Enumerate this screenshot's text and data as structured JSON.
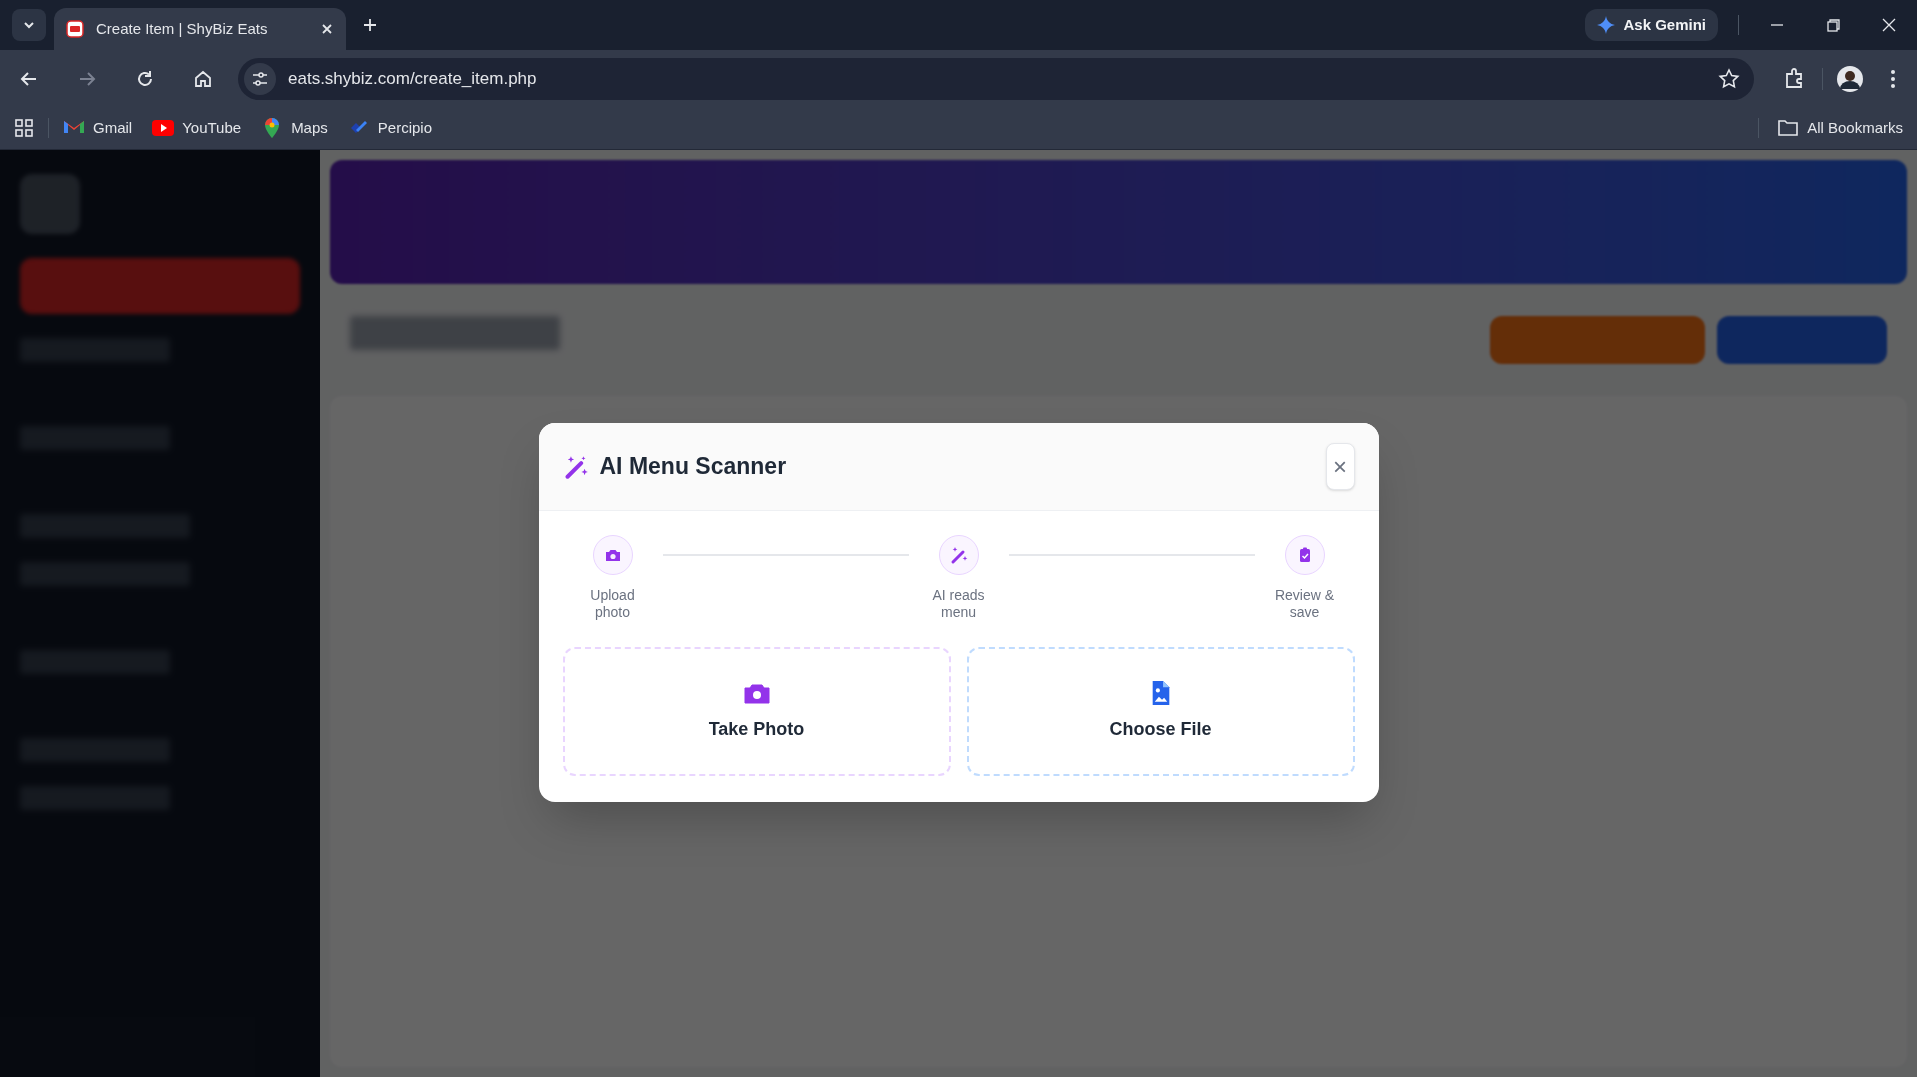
{
  "browser": {
    "tab": {
      "title": "Create Item | ShyBiz Eats",
      "selected": true
    },
    "ask_button": "Ask Gemini",
    "url": "eats.shybiz.com/create_item.php",
    "bookmarks": [
      {
        "label": "Gmail",
        "kind": "gmail"
      },
      {
        "label": "YouTube",
        "kind": "youtube"
      },
      {
        "label": "Maps",
        "kind": "maps"
      },
      {
        "label": "Percipio",
        "kind": "percipio"
      }
    ],
    "all_bookmarks": "All Bookmarks"
  },
  "modal": {
    "title": "AI Menu Scanner",
    "close": "×",
    "steps": [
      {
        "label": "Upload photo",
        "kind": "upload"
      },
      {
        "label": "AI reads menu",
        "kind": "ai"
      },
      {
        "label": "Review & save",
        "kind": "review"
      }
    ],
    "options": [
      {
        "label": "Take Photo",
        "kind": "camera"
      },
      {
        "label": "Choose File",
        "kind": "file"
      }
    ]
  }
}
